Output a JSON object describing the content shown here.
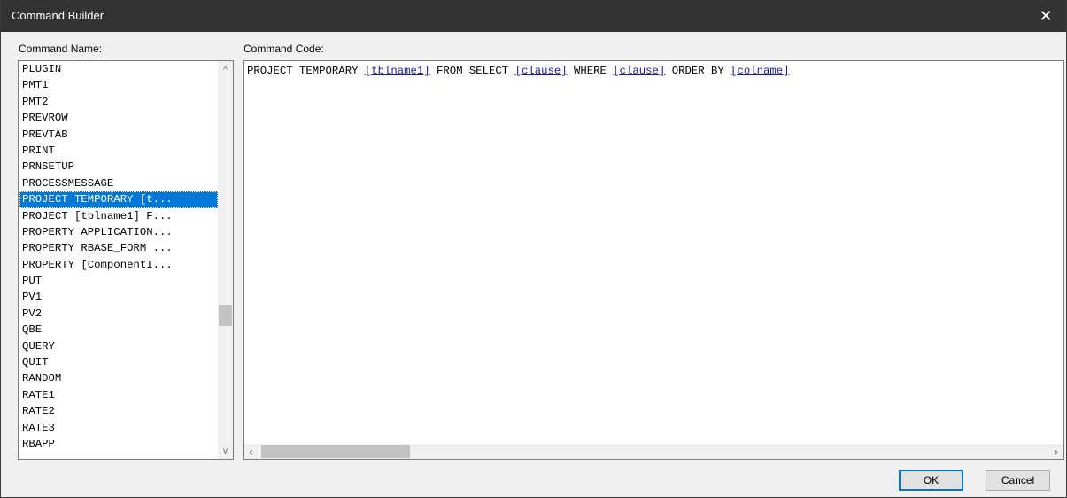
{
  "window": {
    "title": "Command Builder",
    "close_label": "✕"
  },
  "labels": {
    "command_name": "Command Name:",
    "command_code": "Command Code:"
  },
  "command_list": {
    "items": [
      "PLUGIN",
      "PMT1",
      "PMT2",
      "PREVROW",
      "PREVTAB",
      "PRINT",
      "PRNSETUP",
      "PROCESSMESSAGE",
      "PROJECT TEMPORARY [t...",
      "PROJECT [tblname1] F...",
      "PROPERTY APPLICATION...",
      "PROPERTY RBASE_FORM ...",
      "PROPERTY [ComponentI...",
      "PUT",
      "PV1",
      "PV2",
      "QBE",
      "QUERY",
      "QUIT",
      "RANDOM",
      "RATE1",
      "RATE2",
      "RATE3",
      "RBAPP"
    ],
    "selected_index": 8,
    "scroll_up": "^",
    "scroll_down": "v"
  },
  "command_code": {
    "segments": [
      {
        "text": "PROJECT TEMPORARY ",
        "link": false
      },
      {
        "text": "[tblname1]",
        "link": true
      },
      {
        "text": " FROM SELECT ",
        "link": false
      },
      {
        "text": "[clause]",
        "link": true
      },
      {
        "text": " WHERE ",
        "link": false
      },
      {
        "text": "[clause]",
        "link": true
      },
      {
        "text": " ORDER BY ",
        "link": false
      },
      {
        "text": "[colname]",
        "link": true
      }
    ],
    "scroll_left": "‹",
    "scroll_right": "›"
  },
  "buttons": {
    "ok": "OK",
    "cancel": "Cancel"
  },
  "colors": {
    "titlebar": "#333333",
    "selection": "#0078d7",
    "link": "#1a1aa6"
  }
}
